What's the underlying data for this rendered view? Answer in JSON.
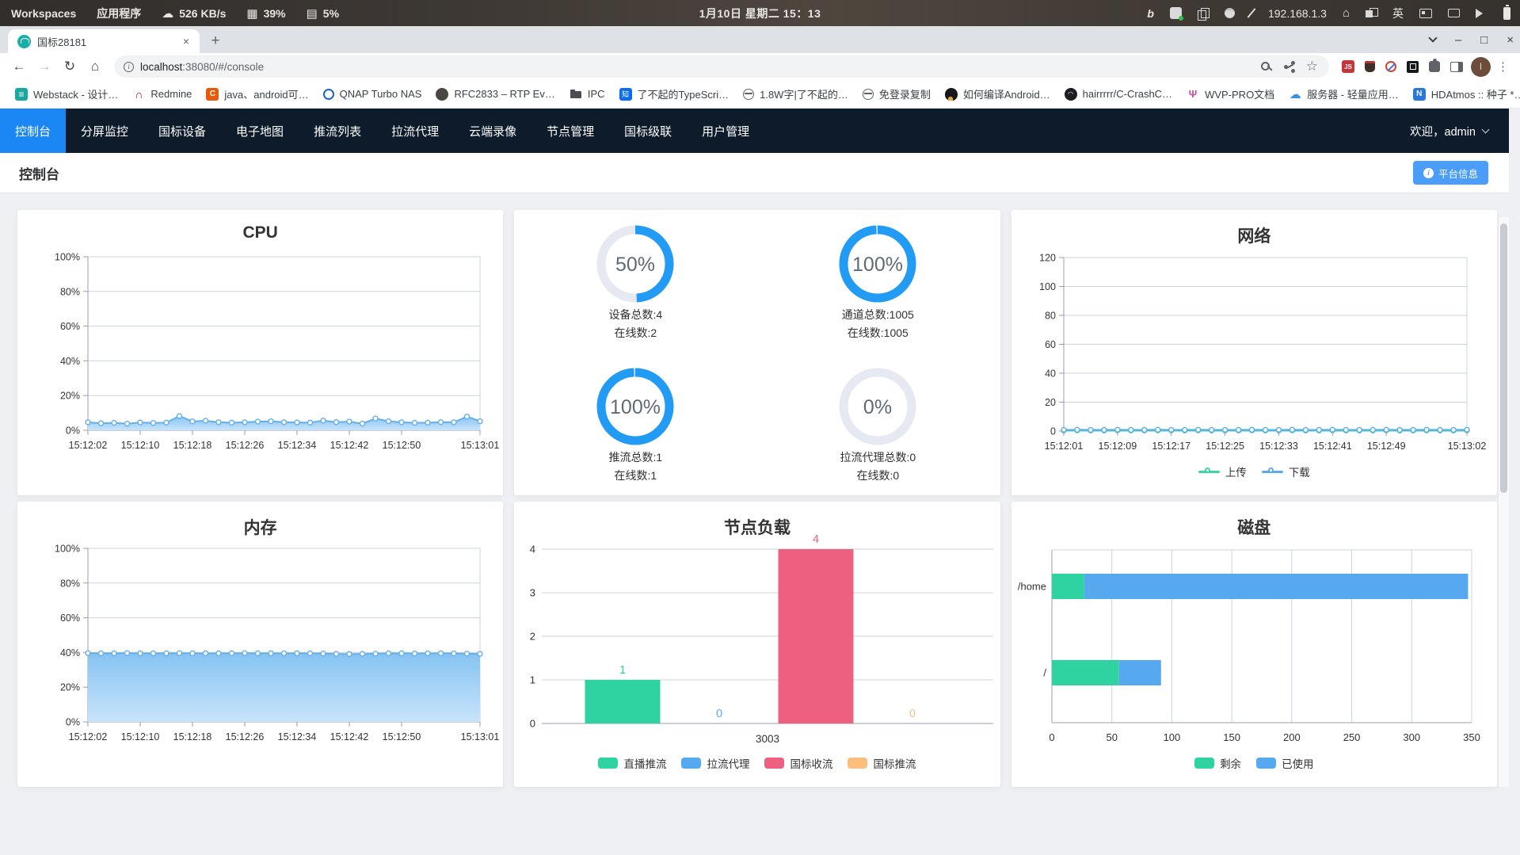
{
  "os_bar": {
    "workspaces": "Workspaces",
    "applications": "应用程序",
    "net_speed": "526 KB/s",
    "cpu_pct": "39%",
    "mem_pct": "5%",
    "clock": "1月10日 星期二 15：13",
    "ip": "192.168.1.3",
    "ime": "英"
  },
  "browser": {
    "tab_title": "国标28181",
    "url_host": "localhost",
    "url_rest": ":38080/#/console",
    "overflow_chevron": "»",
    "bookmarks": [
      {
        "icon": "stack",
        "label": "Webstack - 设计…"
      },
      {
        "icon": "redmine",
        "label": "Redmine"
      },
      {
        "icon": "c",
        "label": "java、android可…"
      },
      {
        "icon": "qnap",
        "label": "QNAP Turbo NAS"
      },
      {
        "icon": "knot",
        "label": "RFC2833 – RTP Ev…"
      },
      {
        "icon": "folder",
        "label": "IPC"
      },
      {
        "icon": "zhihu",
        "label": "了不起的TypeScri…"
      },
      {
        "icon": "globe",
        "label": "1.8W字|了不起的…"
      },
      {
        "icon": "globe",
        "label": "免登录复制"
      },
      {
        "icon": "penguin",
        "label": "如何编译Android…"
      },
      {
        "icon": "github",
        "label": "hairrrrr/C-CrashC…"
      },
      {
        "icon": "wvp",
        "label": "WVP-PRO文档"
      },
      {
        "icon": "cloud",
        "label": "服务器 - 轻量应用…"
      },
      {
        "icon": "n",
        "label": "HDAtmos :: 种子 *…"
      }
    ]
  },
  "navbar": {
    "items": [
      "控制台",
      "分屏监控",
      "国标设备",
      "电子地图",
      "推流列表",
      "拉流代理",
      "云端录像",
      "节点管理",
      "国标级联",
      "用户管理"
    ],
    "active_index": 0,
    "welcome": "欢迎，admin"
  },
  "page": {
    "title": "控制台",
    "platform_button": "平台信息"
  },
  "chart_data": [
    {
      "id": "cpu",
      "type": "area",
      "title": "CPU",
      "ylabels": [
        "0%",
        "20%",
        "40%",
        "60%",
        "80%",
        "100%"
      ],
      "ymax": 100,
      "x_tick_labels": [
        "15:12:02",
        "15:12:10",
        "15:12:18",
        "15:12:26",
        "15:12:34",
        "15:12:42",
        "15:12:50",
        "15:13:01"
      ],
      "x_tick_idx": [
        0,
        4,
        8,
        12,
        16,
        20,
        24,
        30
      ],
      "line_color": "#64afec",
      "fill_top": "#86c3f2",
      "fill_bottom": "#c8e4fb",
      "values": [
        4.6,
        4.0,
        4.3,
        3.8,
        4.5,
        4.2,
        4.4,
        8.2,
        5.1,
        5.5,
        4.6,
        4.4,
        4.6,
        5.0,
        5.2,
        4.6,
        4.5,
        4.4,
        5.6,
        4.7,
        5.0,
        3.8,
        6.8,
        5.2,
        4.6,
        4.3,
        4.4,
        4.7,
        4.6,
        7.9,
        5.2
      ]
    },
    {
      "id": "stats",
      "type": "donut-grid",
      "ring_color": "#219bf4",
      "track_color": "#e6e9f1",
      "pct_color": "#5e6a76",
      "items": [
        {
          "pct": 50,
          "pct_label": "50%",
          "line1": "设备总数:4",
          "line2": "在线数:2"
        },
        {
          "pct": 100,
          "pct_label": "100%",
          "line1": "通道总数:1005",
          "line2": "在线数:1005"
        },
        {
          "pct": 100,
          "pct_label": "100%",
          "line1": "推流总数:1",
          "line2": "在线数:1"
        },
        {
          "pct": 0,
          "pct_label": "0%",
          "line1": "拉流代理总数:0",
          "line2": "在线数:0"
        }
      ]
    },
    {
      "id": "network",
      "type": "line",
      "title": "网络",
      "ylabels": [
        "0",
        "20",
        "40",
        "60",
        "80",
        "100",
        "120"
      ],
      "ymax": 120,
      "x_tick_labels": [
        "15:12:01",
        "15:12:09",
        "15:12:17",
        "15:12:25",
        "15:12:33",
        "15:12:41",
        "15:12:49",
        "15:13:02"
      ],
      "x_tick_idx": [
        0,
        4,
        8,
        12,
        16,
        20,
        24,
        30
      ],
      "series": [
        {
          "name": "上传",
          "color": "#3bd6a8",
          "values": [
            0.4,
            0.5,
            0.4,
            0.4,
            0.5,
            0.4,
            0.4,
            0.5,
            0.4,
            0.4,
            0.5,
            0.4,
            0.4,
            0.4,
            0.5,
            0.4,
            0.4,
            0.5,
            0.4,
            0.4,
            0.5,
            0.4,
            0.4,
            0.4,
            0.5,
            0.4,
            0.4,
            0.5,
            0.4,
            0.4,
            0.5
          ]
        },
        {
          "name": "下载",
          "color": "#59acee",
          "values": [
            0.8,
            0.9,
            0.8,
            0.8,
            0.9,
            0.8,
            0.8,
            0.9,
            0.8,
            0.8,
            0.9,
            0.8,
            0.8,
            0.8,
            0.9,
            0.8,
            0.8,
            0.9,
            0.8,
            0.8,
            0.9,
            0.8,
            0.8,
            0.8,
            0.9,
            0.8,
            0.8,
            0.9,
            0.8,
            0.8,
            0.9
          ]
        }
      ]
    },
    {
      "id": "memory",
      "type": "area",
      "title": "内存",
      "ylabels": [
        "0%",
        "20%",
        "40%",
        "60%",
        "80%",
        "100%"
      ],
      "ymax": 100,
      "x_tick_labels": [
        "15:12:02",
        "15:12:10",
        "15:12:18",
        "15:12:26",
        "15:12:34",
        "15:12:42",
        "15:12:50",
        "15:13:01"
      ],
      "x_tick_idx": [
        0,
        4,
        8,
        12,
        16,
        20,
        24,
        30
      ],
      "line_color": "#64afec",
      "fill_top": "#86c3f2",
      "fill_bottom": "#c8e4fb",
      "values": [
        39.6,
        39.5,
        39.5,
        39.6,
        39.5,
        39.5,
        39.5,
        39.6,
        39.5,
        39.5,
        39.5,
        39.5,
        39.6,
        39.5,
        39.5,
        39.5,
        39.5,
        39.5,
        39.4,
        39.2,
        39.1,
        39.2,
        39.3,
        39.5,
        39.5,
        39.4,
        39.5,
        39.5,
        39.4,
        39.3,
        39.2
      ]
    },
    {
      "id": "load",
      "type": "bar",
      "title": "节点负载",
      "ylabels": [
        "0",
        "1",
        "2",
        "3",
        "4"
      ],
      "ymax": 4,
      "category": "3003",
      "series": [
        {
          "name": "直播推流",
          "color": "#2fd3a2",
          "value": 1
        },
        {
          "name": "拉流代理",
          "color": "#56a9ef",
          "value": 0
        },
        {
          "name": "国标收流",
          "color": "#ee607f",
          "value": 4
        },
        {
          "name": "国标推流",
          "color": "#fbbe7d",
          "value": 0
        }
      ]
    },
    {
      "id": "disk",
      "type": "hbar",
      "title": "磁盘",
      "categories": [
        "/home",
        "/"
      ],
      "xlabels": [
        "0",
        "50",
        "100",
        "150",
        "200",
        "250",
        "300",
        "350"
      ],
      "xmax": 350,
      "series": [
        {
          "name": "剩余",
          "color": "#2fd3a2",
          "values": [
            27,
            56
          ]
        },
        {
          "name": "已使用",
          "color": "#56a9ef",
          "values": [
            320,
            35
          ]
        }
      ]
    }
  ]
}
